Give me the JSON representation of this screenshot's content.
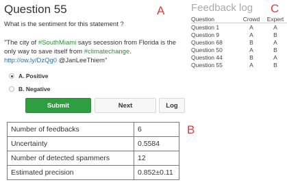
{
  "question": {
    "title": "Question 55",
    "prompt": "What is the sentiment for this statement ?",
    "tweet": {
      "t1": "\"The city of ",
      "h1": "#SouthMiami",
      "t2": " says secession from Florida is the only way to save itself from ",
      "h2": "#climatechange",
      "t3": ".",
      "url": "http://ow.ly/DzQg0",
      "t4": " @JanLeeThiem\""
    },
    "options": [
      {
        "label": "A. Positive",
        "selected": true
      },
      {
        "label": "B. Negative",
        "selected": false
      }
    ],
    "buttons": {
      "submit": "Submit",
      "next": "Next",
      "log": "Log"
    }
  },
  "panel_letters": {
    "a": "A",
    "b": "B",
    "c": "C"
  },
  "colors": {
    "accent_letter": "#e03a3a",
    "submit": "#2e9e40",
    "link": "#2a8d3a",
    "url": "#2a6fb3"
  },
  "feedback_log": {
    "title": "Feedback log",
    "headers": [
      "Question",
      "Crowd",
      "Expert"
    ],
    "rows": [
      [
        "Question 1",
        "A",
        "A"
      ],
      [
        "Question 9",
        "A",
        "B"
      ],
      [
        "Question 68",
        "B",
        "A"
      ],
      [
        "Question 50",
        "A",
        "B"
      ],
      [
        "Question 44",
        "B",
        "A"
      ],
      [
        "Question 55",
        "A",
        "B"
      ]
    ]
  },
  "stats": [
    {
      "label": "Number of feedbacks",
      "value": "6"
    },
    {
      "label": "Uncertainty",
      "value": "0.5584"
    },
    {
      "label": "Number of detected spammers",
      "value": "12"
    },
    {
      "label": "Estimated precision",
      "value": "0.852±0.11"
    }
  ]
}
